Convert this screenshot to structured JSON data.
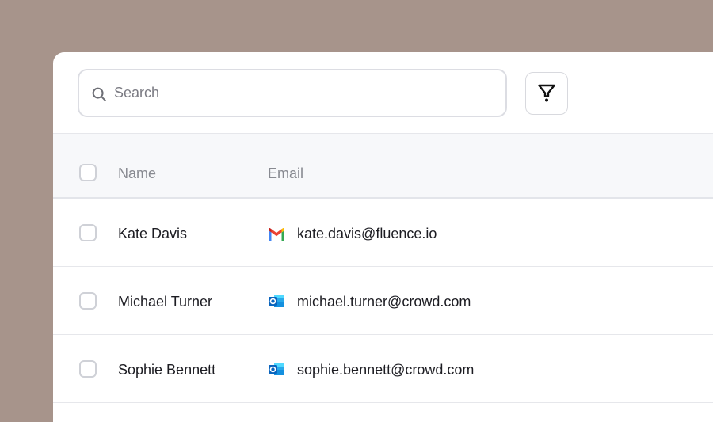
{
  "search": {
    "placeholder": "Search"
  },
  "toolbar": {
    "filter_icon": "filter-funnel-icon"
  },
  "table": {
    "columns": [
      "Name",
      "Email"
    ],
    "rows": [
      {
        "name": "Kate Davis",
        "email": "kate.davis@fluence.io",
        "provider_icon": "gmail-icon"
      },
      {
        "name": "Michael Turner",
        "email": "michael.turner@crowd.com",
        "provider_icon": "outlook-icon"
      },
      {
        "name": "Sophie Bennett",
        "email": "sophie.bennett@crowd.com",
        "provider_icon": "outlook-icon"
      }
    ]
  },
  "colors": {
    "background": "#a7948b",
    "card": "#ffffff",
    "header_bg": "#f7f8fa",
    "border": "#e6e7eb",
    "muted_text": "#888a91",
    "text": "#1c1c22"
  }
}
